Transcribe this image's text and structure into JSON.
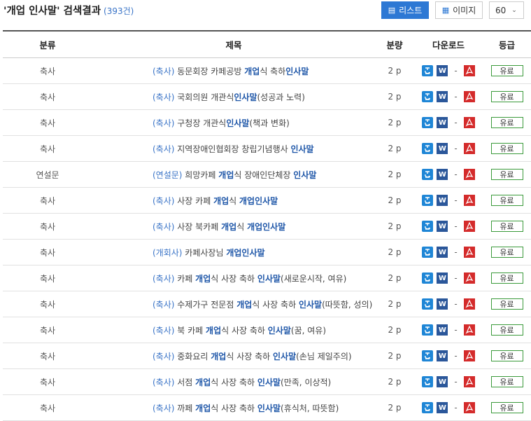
{
  "header": {
    "title": "'개업 인사말' 검색결과",
    "count": "(393건)",
    "list_button": "리스트",
    "list_icon": "list-icon",
    "image_button": "이미지",
    "image_icon": "grid-icon",
    "page_size": "60"
  },
  "columns": [
    "분류",
    "제목",
    "분량",
    "다운로드",
    "등급"
  ],
  "download_separator": "-",
  "colors": {
    "accent": "#2d78d4",
    "keyword": "#1e56a8",
    "grade_border": "#3a9a3a",
    "pdf": "#d42b2b",
    "word": "#2b579a",
    "hwp": "#1f86d6"
  },
  "rows": [
    {
      "category": "축사",
      "tag": "(축사)",
      "parts": [
        {
          "t": " 동문회장 카페공방 "
        },
        {
          "t": "개업",
          "k": 1
        },
        {
          "t": "식 축하"
        },
        {
          "t": "인사말",
          "k": 1
        }
      ],
      "volume": "2 p",
      "grade": "유료"
    },
    {
      "category": "축사",
      "tag": "(축사)",
      "parts": [
        {
          "t": " 국회의원 개관식"
        },
        {
          "t": "인사말",
          "k": 1
        },
        {
          "t": "(성공과 노력)"
        }
      ],
      "volume": "2 p",
      "grade": "유료"
    },
    {
      "category": "축사",
      "tag": "(축사)",
      "parts": [
        {
          "t": " 구청장 개관식"
        },
        {
          "t": "인사말",
          "k": 1
        },
        {
          "t": "(책과 변화)"
        }
      ],
      "volume": "2 p",
      "grade": "유료"
    },
    {
      "category": "축사",
      "tag": "(축사)",
      "parts": [
        {
          "t": " 지역장애인협회장 창립기념행사 "
        },
        {
          "t": "인사말",
          "k": 1
        }
      ],
      "volume": "2 p",
      "grade": "유료"
    },
    {
      "category": "연설문",
      "tag": "(연설문)",
      "parts": [
        {
          "t": " 희망카페 "
        },
        {
          "t": "개업",
          "k": 1
        },
        {
          "t": "식 장애인단체장 "
        },
        {
          "t": "인사말",
          "k": 1
        }
      ],
      "volume": "2 p",
      "grade": "유료"
    },
    {
      "category": "축사",
      "tag": "(축사)",
      "parts": [
        {
          "t": " 사장 카페 "
        },
        {
          "t": "개업",
          "k": 1
        },
        {
          "t": "식 "
        },
        {
          "t": "개업인사말",
          "k": 1
        }
      ],
      "volume": "2 p",
      "grade": "유료"
    },
    {
      "category": "축사",
      "tag": "(축사)",
      "parts": [
        {
          "t": " 사장 북카페 "
        },
        {
          "t": "개업",
          "k": 1
        },
        {
          "t": "식 "
        },
        {
          "t": "개업인사말",
          "k": 1
        }
      ],
      "volume": "2 p",
      "grade": "유료"
    },
    {
      "category": "축사",
      "tag": "(개회사)",
      "parts": [
        {
          "t": " 카페사장님 "
        },
        {
          "t": "개업인사말",
          "k": 1
        }
      ],
      "volume": "2 p",
      "grade": "유료"
    },
    {
      "category": "축사",
      "tag": "(축사)",
      "parts": [
        {
          "t": " 카페 "
        },
        {
          "t": "개업",
          "k": 1
        },
        {
          "t": "식 사장 축하 "
        },
        {
          "t": "인사말",
          "k": 1
        },
        {
          "t": "(새로운시작, 여유)"
        }
      ],
      "volume": "2 p",
      "grade": "유료"
    },
    {
      "category": "축사",
      "tag": "(축사)",
      "parts": [
        {
          "t": " 수제가구 전문점 "
        },
        {
          "t": "개업",
          "k": 1
        },
        {
          "t": "식 사장 축하 "
        },
        {
          "t": "인사말",
          "k": 1
        },
        {
          "t": "(따뜻함, 성의)"
        }
      ],
      "volume": "2 p",
      "grade": "유료"
    },
    {
      "category": "축사",
      "tag": "(축사)",
      "parts": [
        {
          "t": " 북 카페 "
        },
        {
          "t": "개업",
          "k": 1
        },
        {
          "t": "식 사장 축하 "
        },
        {
          "t": "인사말",
          "k": 1
        },
        {
          "t": "(꿈, 여유)"
        }
      ],
      "volume": "2 p",
      "grade": "유료"
    },
    {
      "category": "축사",
      "tag": "(축사)",
      "parts": [
        {
          "t": " 중화요리 "
        },
        {
          "t": "개업",
          "k": 1
        },
        {
          "t": "식 사장 축하 "
        },
        {
          "t": "인사말",
          "k": 1
        },
        {
          "t": "(손님 제일주의)"
        }
      ],
      "volume": "2 p",
      "grade": "유료"
    },
    {
      "category": "축사",
      "tag": "(축사)",
      "parts": [
        {
          "t": " 서점 "
        },
        {
          "t": "개업",
          "k": 1
        },
        {
          "t": "식 사장 축하 "
        },
        {
          "t": "인사말",
          "k": 1
        },
        {
          "t": "(만족, 이상적)"
        }
      ],
      "volume": "2 p",
      "grade": "유료"
    },
    {
      "category": "축사",
      "tag": "(축사)",
      "parts": [
        {
          "t": " 까페 "
        },
        {
          "t": "개업",
          "k": 1
        },
        {
          "t": "식 사장 축하 "
        },
        {
          "t": "인사말",
          "k": 1
        },
        {
          "t": "(휴식처, 따뜻함)"
        }
      ],
      "volume": "2 p",
      "grade": "유료"
    }
  ]
}
